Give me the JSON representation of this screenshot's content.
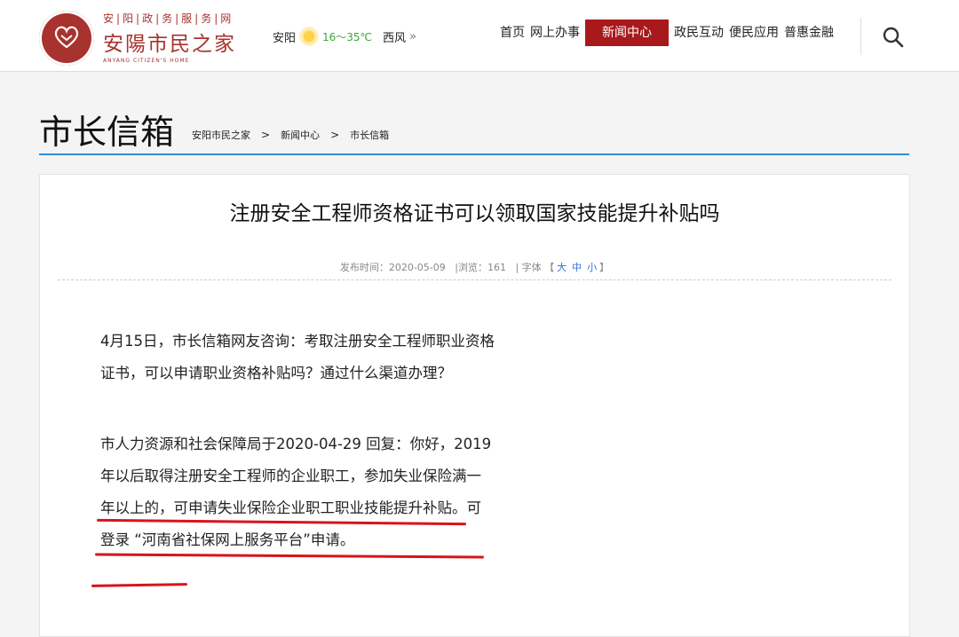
{
  "header": {
    "logo_small": "安|阳|政|务|服|务|网",
    "logo_big": "安陽市民之家",
    "logo_en": "ANYANG CITIZEN'S HOME",
    "weather_city": "安阳",
    "weather_temp": "16～35℃",
    "weather_wind": "西风",
    "weather_more": "»"
  },
  "nav": {
    "items": [
      {
        "label": "首页"
      },
      {
        "label": "网上办事"
      },
      {
        "label": "新闻中心",
        "active": true
      },
      {
        "label": "政民互动"
      },
      {
        "label": "便民应用"
      },
      {
        "label": "普惠金融"
      }
    ]
  },
  "page": {
    "title": "市长信箱",
    "breadcrumb": [
      "安阳市民之家",
      "新闻中心",
      "市长信箱"
    ],
    "breadcrumb_sep": ">"
  },
  "article": {
    "title": "注册安全工程师资格证书可以领取国家技能提升补贴吗",
    "meta_publish": "发布时间：2020-05-09",
    "meta_views": "|浏览：161",
    "meta_font_label": "| 字体",
    "meta_font_open": "【",
    "font_large": "大",
    "font_medium": "中",
    "font_small": "小",
    "meta_font_close": "】",
    "paragraph1": "4月15日，市长信箱网友咨询：考取注册安全工程师职业资格证书，可以申请职业资格补贴吗？通过什么渠道办理？",
    "paragraph2": "市人力资源和社会保障局于2020-04-29 回复：你好，2019年以后取得注册安全工程师的企业职工，参加失业保险满一年以上的，可申请失业保险企业职工职业技能提升补贴。可登录 “河南省社保网上服务平台”申请。"
  },
  "colors": {
    "brand_red": "#a8322e",
    "nav_active": "#a8191c",
    "accent_blue": "#2f8fd8",
    "highlight_underline": "#d8141a"
  }
}
